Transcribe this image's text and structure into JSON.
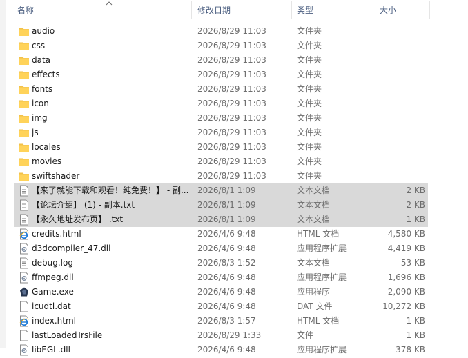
{
  "columns": {
    "name": "名称",
    "date": "修改日期",
    "type": "类型",
    "size": "大小"
  },
  "files": [
    {
      "name": "audio",
      "date": "2026/8/29 11:03",
      "type": "文件夹",
      "size": "",
      "icon": "folder-icon"
    },
    {
      "name": "css",
      "date": "2026/8/29 11:03",
      "type": "文件夹",
      "size": "",
      "icon": "folder-icon"
    },
    {
      "name": "data",
      "date": "2026/8/29 11:03",
      "type": "文件夹",
      "size": "",
      "icon": "folder-icon"
    },
    {
      "name": "effects",
      "date": "2026/8/29 11:03",
      "type": "文件夹",
      "size": "",
      "icon": "folder-icon"
    },
    {
      "name": "fonts",
      "date": "2026/8/29 11:03",
      "type": "文件夹",
      "size": "",
      "icon": "folder-icon"
    },
    {
      "name": "icon",
      "date": "2026/8/29 11:03",
      "type": "文件夹",
      "size": "",
      "icon": "folder-icon"
    },
    {
      "name": "img",
      "date": "2026/8/29 11:03",
      "type": "文件夹",
      "size": "",
      "icon": "folder-icon"
    },
    {
      "name": "js",
      "date": "2026/8/29 11:03",
      "type": "文件夹",
      "size": "",
      "icon": "folder-icon"
    },
    {
      "name": "locales",
      "date": "2026/8/29 11:03",
      "type": "文件夹",
      "size": "",
      "icon": "folder-icon"
    },
    {
      "name": "movies",
      "date": "2026/8/29 11:03",
      "type": "文件夹",
      "size": "",
      "icon": "folder-icon"
    },
    {
      "name": "swiftshader",
      "date": "2026/8/29 11:03",
      "type": "文件夹",
      "size": "",
      "icon": "folder-icon"
    },
    {
      "name": "【来了就能下载和观看！纯免费！】 - 副...",
      "date": "2026/8/1 1:09",
      "type": "文本文档",
      "size": "2 KB",
      "icon": "text-file-icon",
      "selected": true
    },
    {
      "name": "【论坛介绍】 (1) - 副本.txt",
      "date": "2026/8/1 1:09",
      "type": "文本文档",
      "size": "2 KB",
      "icon": "text-file-icon",
      "selected": true
    },
    {
      "name": "【永久地址发布页】 .txt",
      "date": "2026/8/1 1:09",
      "type": "文本文档",
      "size": "1 KB",
      "icon": "text-file-icon",
      "selected": true
    },
    {
      "name": "credits.html",
      "date": "2026/4/6 9:48",
      "type": "HTML 文档",
      "size": "4,580 KB",
      "icon": "ie-html-icon"
    },
    {
      "name": "d3dcompiler_47.dll",
      "date": "2026/4/6 9:48",
      "type": "应用程序扩展",
      "size": "4,419 KB",
      "icon": "dll-file-icon"
    },
    {
      "name": "debug.log",
      "date": "2026/8/3 1:52",
      "type": "文本文档",
      "size": "53 KB",
      "icon": "text-file-icon"
    },
    {
      "name": "ffmpeg.dll",
      "date": "2026/4/6 9:48",
      "type": "应用程序扩展",
      "size": "1,696 KB",
      "icon": "dll-file-icon"
    },
    {
      "name": "Game.exe",
      "date": "2026/4/6 9:48",
      "type": "应用程序",
      "size": "2,090 KB",
      "icon": "game-app-icon"
    },
    {
      "name": "icudtl.dat",
      "date": "2026/4/6 9:48",
      "type": "DAT 文件",
      "size": "10,272 KB",
      "icon": "blank-file-icon"
    },
    {
      "name": "index.html",
      "date": "2026/8/3 1:57",
      "type": "HTML 文档",
      "size": "1 KB",
      "icon": "ie-html-icon"
    },
    {
      "name": "lastLoadedTrsFile",
      "date": "2026/8/29 1:33",
      "type": "文件",
      "size": "1 KB",
      "icon": "blank-file-icon"
    },
    {
      "name": "libEGL.dll",
      "date": "2026/4/6 9:48",
      "type": "应用程序扩展",
      "size": "378 KB",
      "icon": "dll-file-icon"
    }
  ],
  "colors": {
    "selection": "#d9d9d9",
    "header_text": "#4d6082",
    "folder": "#ffd35a"
  }
}
